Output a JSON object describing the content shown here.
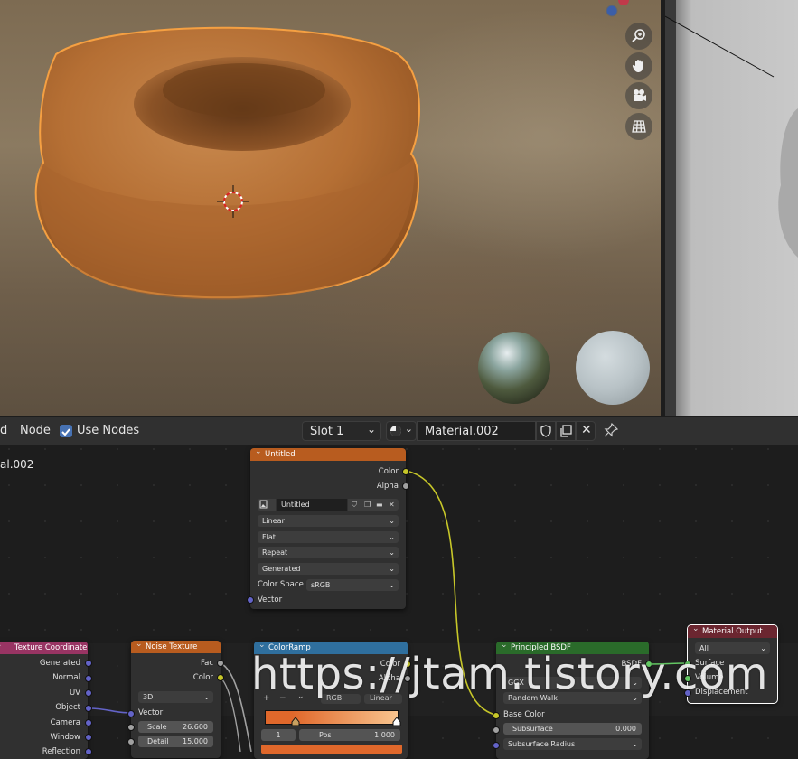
{
  "header": {
    "menu_fragment": "d",
    "node_menu": "Node",
    "use_nodes_label": "Use Nodes",
    "slot_value": "Slot 1",
    "material_name": "Material.002"
  },
  "sidebar": {
    "material_fragment": "al.002"
  },
  "nodes": {
    "image_texture": {
      "title": "Untitled",
      "out_color": "Color",
      "out_alpha": "Alpha",
      "image_name": "Untitled",
      "interpolation": "Linear",
      "projection": "Flat",
      "extension": "Repeat",
      "source": "Generated",
      "color_space_label": "Color Space",
      "color_space_value": "sRGB",
      "in_vector": "Vector"
    },
    "texture_coordinate": {
      "title": "Texture Coordinate",
      "outputs": [
        "Generated",
        "Normal",
        "UV",
        "Object",
        "Camera",
        "Window",
        "Reflection"
      ]
    },
    "noise_texture": {
      "title": "Noise Texture",
      "out_fac": "Fac",
      "out_color": "Color",
      "dimension": "3D",
      "in_vector": "Vector",
      "scale_label": "Scale",
      "scale_value": "26.600",
      "detail_label": "Detail",
      "detail_value": "15.000"
    },
    "color_ramp": {
      "title": "ColorRamp",
      "out_color": "Color",
      "out_alpha": "Alpha",
      "color_mode": "RGB",
      "interpolation": "Linear",
      "stop_index": "1",
      "pos_label": "Pos",
      "pos_value": "1.000",
      "ramp_from": "#e0682b",
      "ramp_to": "#f8c48e"
    },
    "principled_bsdf": {
      "title": "Principled BSDF",
      "out_bsdf": "BSDF",
      "distribution": "GGX",
      "subsurface_method": "Random Walk",
      "base_color_label": "Base Color",
      "subsurface_label": "Subsurface",
      "subsurface_value": "0.000",
      "subsurface_radius_label": "Subsurface Radius"
    },
    "material_output": {
      "title": "Material Output",
      "target": "All",
      "in_surface": "Surface",
      "in_volume": "Volume",
      "in_displacement": "Displacement"
    }
  },
  "watermark": "https://jtam.tistory.com",
  "colors": {
    "accent": "#4772b3",
    "selection_outline": "#f5a042",
    "texture_header": "#b85c1f",
    "input_header": "#983463",
    "color_header": "#2f6f9e",
    "shader_header": "#2a6b2a",
    "output_header": "#6b2630"
  },
  "icons": [
    "zoom-icon",
    "hand-icon",
    "camera-icon",
    "grid-icon",
    "shield-icon",
    "duplicate-icon",
    "close-icon",
    "pin-icon",
    "material-sphere-icon",
    "image-icon",
    "folder-icon"
  ]
}
